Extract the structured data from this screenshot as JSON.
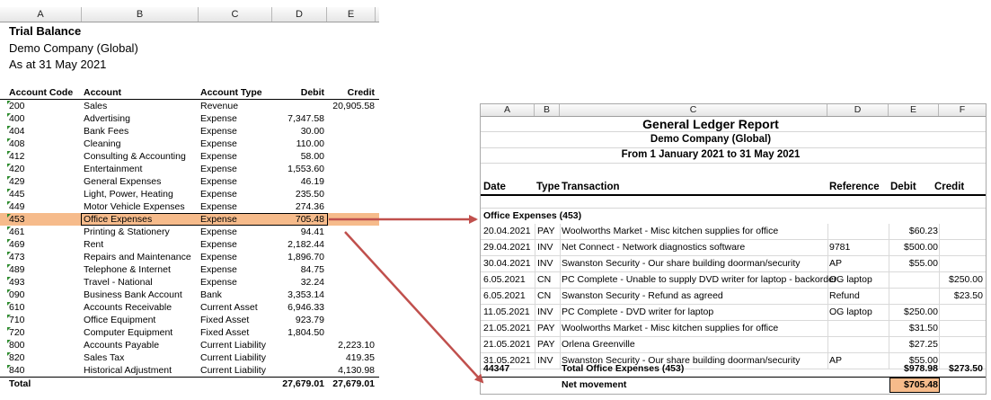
{
  "trial_balance": {
    "column_letters": [
      "A",
      "B",
      "C",
      "D",
      "E"
    ],
    "title": "Trial Balance",
    "company": "Demo Company (Global)",
    "as_at": "As at 31 May 2021",
    "headers": {
      "code": "Account Code",
      "account": "Account",
      "type": "Account Type",
      "debit": "Debit",
      "credit": "Credit"
    },
    "rows": [
      {
        "code": "200",
        "account": "Sales",
        "type": "Revenue",
        "debit": "",
        "credit": "20,905.58"
      },
      {
        "code": "400",
        "account": "Advertising",
        "type": "Expense",
        "debit": "7,347.58",
        "credit": ""
      },
      {
        "code": "404",
        "account": "Bank Fees",
        "type": "Expense",
        "debit": "30.00",
        "credit": ""
      },
      {
        "code": "408",
        "account": "Cleaning",
        "type": "Expense",
        "debit": "110.00",
        "credit": ""
      },
      {
        "code": "412",
        "account": "Consulting & Accounting",
        "type": "Expense",
        "debit": "58.00",
        "credit": ""
      },
      {
        "code": "420",
        "account": "Entertainment",
        "type": "Expense",
        "debit": "1,553.60",
        "credit": ""
      },
      {
        "code": "429",
        "account": "General Expenses",
        "type": "Expense",
        "debit": "46.19",
        "credit": ""
      },
      {
        "code": "445",
        "account": "Light, Power, Heating",
        "type": "Expense",
        "debit": "235.50",
        "credit": ""
      },
      {
        "code": "449",
        "account": "Motor Vehicle Expenses",
        "type": "Expense",
        "debit": "274.36",
        "credit": ""
      },
      {
        "code": "453",
        "account": "Office Expenses",
        "type": "Expense",
        "debit": "705.48",
        "credit": "",
        "highlight": true
      },
      {
        "code": "461",
        "account": "Printing & Stationery",
        "type": "Expense",
        "debit": "94.41",
        "credit": ""
      },
      {
        "code": "469",
        "account": "Rent",
        "type": "Expense",
        "debit": "2,182.44",
        "credit": ""
      },
      {
        "code": "473",
        "account": "Repairs and Maintenance",
        "type": "Expense",
        "debit": "1,896.70",
        "credit": ""
      },
      {
        "code": "489",
        "account": "Telephone & Internet",
        "type": "Expense",
        "debit": "84.75",
        "credit": ""
      },
      {
        "code": "493",
        "account": "Travel - National",
        "type": "Expense",
        "debit": "32.24",
        "credit": ""
      },
      {
        "code": "090",
        "account": "Business Bank Account",
        "type": "Bank",
        "debit": "3,353.14",
        "credit": ""
      },
      {
        "code": "610",
        "account": "Accounts Receivable",
        "type": "Current Asset",
        "debit": "6,946.33",
        "credit": ""
      },
      {
        "code": "710",
        "account": "Office Equipment",
        "type": "Fixed Asset",
        "debit": "923.79",
        "credit": ""
      },
      {
        "code": "720",
        "account": "Computer Equipment",
        "type": "Fixed Asset",
        "debit": "1,804.50",
        "credit": ""
      },
      {
        "code": "800",
        "account": "Accounts Payable",
        "type": "Current Liability",
        "debit": "",
        "credit": "2,223.10"
      },
      {
        "code": "820",
        "account": "Sales Tax",
        "type": "Current Liability",
        "debit": "",
        "credit": "419.35"
      },
      {
        "code": "840",
        "account": "Historical Adjustment",
        "type": "Current Liability",
        "debit": "",
        "credit": "4,130.98"
      }
    ],
    "total": {
      "label": "Total",
      "debit": "27,679.01",
      "credit": "27,679.01"
    }
  },
  "general_ledger": {
    "column_letters": [
      "A",
      "B",
      "C",
      "D",
      "E",
      "F"
    ],
    "title": "General Ledger Report",
    "company": "Demo Company (Global)",
    "range": "From 1 January 2021 to 31 May 2021",
    "headers": {
      "date": "Date",
      "type": "Type",
      "transaction": "Transaction",
      "reference": "Reference",
      "debit": "Debit",
      "credit": "Credit"
    },
    "section": "Office Expenses (453)",
    "rows": [
      {
        "date": "20.04.2021",
        "type": "PAY",
        "transaction": "Woolworths Market - Misc kitchen supplies for office",
        "reference": "",
        "debit": "$60.23",
        "credit": ""
      },
      {
        "date": "29.04.2021",
        "type": "INV",
        "transaction": "Net Connect - Network diagnostics software",
        "reference": "9781",
        "debit": "$500.00",
        "credit": ""
      },
      {
        "date": "30.04.2021",
        "type": "INV",
        "transaction": "Swanston Security - Our share building doorman/security",
        "reference": "AP",
        "debit": "$55.00",
        "credit": ""
      },
      {
        "date": "6.05.2021",
        "type": "CN",
        "transaction": "PC Complete - Unable to supply DVD writer for laptop - backorder",
        "reference": "OG laptop",
        "debit": "",
        "credit": "$250.00"
      },
      {
        "date": "6.05.2021",
        "type": "CN",
        "transaction": "Swanston Security - Refund as agreed",
        "reference": "Refund",
        "debit": "",
        "credit": "$23.50"
      },
      {
        "date": "11.05.2021",
        "type": "INV",
        "transaction": "PC Complete - DVD writer for laptop",
        "reference": "OG laptop",
        "debit": "$250.00",
        "credit": ""
      },
      {
        "date": "21.05.2021",
        "type": "PAY",
        "transaction": "Woolworths Market - Misc kitchen supplies for office",
        "reference": "",
        "debit": "$31.50",
        "credit": ""
      },
      {
        "date": "21.05.2021",
        "type": "PAY",
        "transaction": "Orlena Greenville",
        "reference": "",
        "debit": "$27.25",
        "credit": ""
      },
      {
        "date": "31.05.2021",
        "type": "INV",
        "transaction": "Swanston Security - Our share building doorman/security",
        "reference": "AP",
        "debit": "$55.00",
        "credit": ""
      }
    ],
    "total": {
      "code": "44347",
      "label": "Total Office Expenses (453)",
      "debit": "$978.98",
      "credit": "$273.50"
    },
    "net": {
      "label": "Net movement",
      "value": "$705.48"
    }
  },
  "colors": {
    "highlight": "#f6bb8b",
    "arrow": "#c0504d",
    "marker": "#2e8b2e"
  }
}
